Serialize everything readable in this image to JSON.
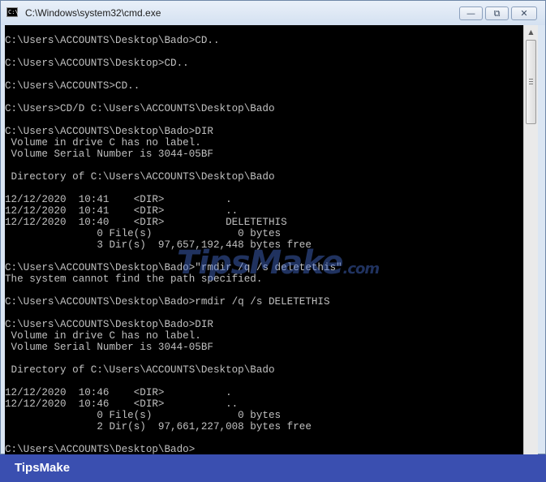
{
  "window": {
    "title": "C:\\Windows\\system32\\cmd.exe",
    "icon": "cmd-icon",
    "controls": {
      "minimize": "—",
      "maximize": "⧉",
      "close": "✕"
    }
  },
  "console": {
    "lines": [
      "C:\\Users\\ACCOUNTS\\Desktop\\Bado>CD..",
      "",
      "C:\\Users\\ACCOUNTS\\Desktop>CD..",
      "",
      "C:\\Users\\ACCOUNTS>CD..",
      "",
      "C:\\Users>CD/D C:\\Users\\ACCOUNTS\\Desktop\\Bado",
      "",
      "C:\\Users\\ACCOUNTS\\Desktop\\Bado>DIR",
      " Volume in drive C has no label.",
      " Volume Serial Number is 3044-05BF",
      "",
      " Directory of C:\\Users\\ACCOUNTS\\Desktop\\Bado",
      "",
      "12/12/2020  10:41    <DIR>          .",
      "12/12/2020  10:41    <DIR>          ..",
      "12/12/2020  10:40    <DIR>          DELETETHIS",
      "               0 File(s)              0 bytes",
      "               3 Dir(s)  97,657,192,448 bytes free",
      "",
      "C:\\Users\\ACCOUNTS\\Desktop\\Bado>\"rmdir /q /s deletethis\"",
      "The system cannot find the path specified.",
      "",
      "C:\\Users\\ACCOUNTS\\Desktop\\Bado>rmdir /q /s DELETETHIS",
      "",
      "C:\\Users\\ACCOUNTS\\Desktop\\Bado>DIR",
      " Volume in drive C has no label.",
      " Volume Serial Number is 3044-05BF",
      "",
      " Directory of C:\\Users\\ACCOUNTS\\Desktop\\Bado",
      "",
      "12/12/2020  10:46    <DIR>          .",
      "12/12/2020  10:46    <DIR>          ..",
      "               0 File(s)              0 bytes",
      "               2 Dir(s)  97,661,227,008 bytes free",
      "",
      "C:\\Users\\ACCOUNTS\\Desktop\\Bado>"
    ]
  },
  "watermark": {
    "text": "TipsMake",
    "suffix": ".com"
  },
  "footer": {
    "brand": "TipsMake"
  },
  "colors": {
    "console_bg": "#000000",
    "console_text": "#c0c0c0",
    "footer_bg": "#3a4fb0",
    "brand_text": "#ffffff"
  }
}
